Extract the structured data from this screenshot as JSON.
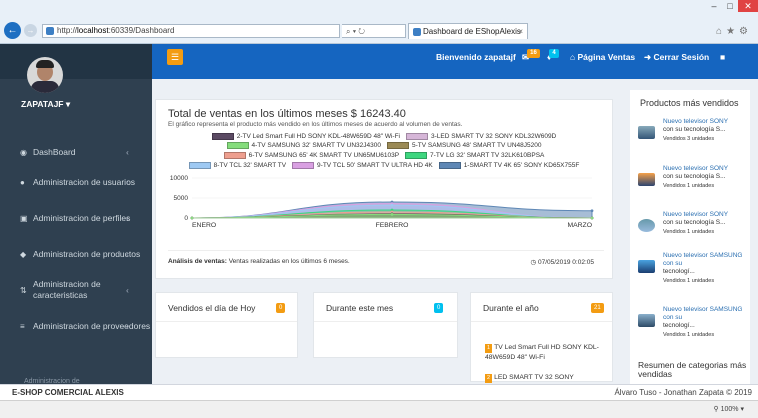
{
  "browser": {
    "url_prefix": "http://",
    "url_host": "localhost",
    "url_rest": ":60339/Dashboard",
    "address_controls": "⌕ ▾ ↻",
    "tab_title": "Dashboard de EShopAlexis",
    "tab_close": "×",
    "zoom": "100%"
  },
  "topbar": {
    "welcome": "Bienvenido zapatajf",
    "messages_badge": "16",
    "notifications_badge": "4",
    "sales_page": "Página Ventas",
    "logout": "Cerrar Sesión"
  },
  "sidebar": {
    "username": "ZAPATAJF ▾",
    "items": [
      {
        "label": "DashBoard"
      },
      {
        "label": "Administracion de usuarios"
      },
      {
        "label": "Administracion de perfiles"
      },
      {
        "label": "Administracion de productos"
      },
      {
        "label": "Administracion de caracteristicas"
      },
      {
        "label": "Administracion de proveedores"
      }
    ],
    "cutoff_item": "Administracion de"
  },
  "chart_card": {
    "title": "Total de ventas en los últimos meses $ 16243.40",
    "subtitle": "El gráfico representa el producto más vendido en los últimos meses de acuerdo al volumen de ventas.",
    "footer_label": "Análisis de ventas:",
    "footer_text": "Ventas realizadas en los últimos 6 meses.",
    "timestamp": "◷ 07/05/2019 0:02:05"
  },
  "chart_data": {
    "type": "area",
    "categories": [
      "ENERO",
      "FEBRERO",
      "MARZO"
    ],
    "y_ticks": [
      "10000",
      "5000",
      "0"
    ],
    "ylim": [
      0,
      10000
    ],
    "legend_position": "top",
    "series": [
      {
        "name": "2-TV Led Smart Full HD SONY KDL-48W659D 48\" Wi-Fi",
        "color": "#5b4a63",
        "values": [
          0,
          1000,
          0
        ]
      },
      {
        "name": "3-LED SMART TV 32 SONY KDL32W609D",
        "color": "#d6b6d8",
        "values": [
          0,
          1200,
          0
        ]
      },
      {
        "name": "4-TV SAMSUNG 32' SMART TV UN32J4300",
        "color": "#85dd7c",
        "values": [
          0,
          900,
          0
        ]
      },
      {
        "name": "5-TV SAMSUNG 48' SMART TV UN48J5200",
        "color": "#9b8a55",
        "values": [
          0,
          1100,
          0
        ]
      },
      {
        "name": "6-TV SAMSUNG 65' 4K SMART TV UN65MU6103P",
        "color": "#ee9f8f",
        "values": [
          0,
          1500,
          0
        ]
      },
      {
        "name": "7-TV LG 32' SMART TV 32LK610BPSA",
        "color": "#3ed67f",
        "values": [
          0,
          2000,
          0
        ]
      },
      {
        "name": "8-TV TCL 32' SMART TV",
        "color": "#9ec9f3",
        "values": [
          0,
          3200,
          0
        ]
      },
      {
        "name": "9-TV TCL 50' SMART TV ULTRA HD 4K",
        "color": "#d9a0e2",
        "values": [
          0,
          3600,
          0
        ]
      },
      {
        "name": "1-SMART TV 4K 65' SONY KD65X755F",
        "color": "#5e87b5",
        "values": [
          0,
          4000,
          1800
        ]
      }
    ]
  },
  "top_products": {
    "heading": "Productos más vendidos",
    "items": [
      {
        "name": "Nuevo televisor SONY",
        "desc": "con su tecnología S...",
        "units": "Vendidos 3 unidades"
      },
      {
        "name": "Nuevo televisor SONY",
        "desc": "con su tecnología S...",
        "units": "Vendidos 1 unidades"
      },
      {
        "name": "Nuevo televisor SONY",
        "desc": "con su tecnología S...",
        "units": "Vendidos 1 unidades"
      },
      {
        "name": "Nuevo televisor SAMSUNG con su",
        "desc": "tecnologí...",
        "units": "Vendidos 1 unidades"
      },
      {
        "name": "Nuevo televisor SAMSUNG con su",
        "desc": "tecnologí...",
        "units": "Vendidos 1 unidades"
      }
    ],
    "summary_heading": "Resumen de categorias más vendidas"
  },
  "stats": {
    "today": {
      "label": "Vendidos el día de Hoy",
      "count": "0"
    },
    "month": {
      "label": "Durante este mes",
      "count": "0"
    },
    "year": {
      "label": "Durante el año",
      "count": "21"
    },
    "year_items": [
      {
        "num": "1",
        "text": "TV Led Smart Full HD SONY KDL-48W659D 48\" Wi-Fi"
      },
      {
        "num": "2",
        "text": "LED SMART TV 32 SONY"
      }
    ]
  },
  "footer": {
    "brand": "E-SHOP COMERCIAL ALEXIS",
    "copyright": "Álvaro Tuso - Jonathan Zapata © 2019"
  },
  "colors": {
    "topbar": "#1565c0",
    "sidebar": "#2f4050",
    "accent_orange": "#f39c12",
    "accent_teal": "#00c0ef"
  }
}
